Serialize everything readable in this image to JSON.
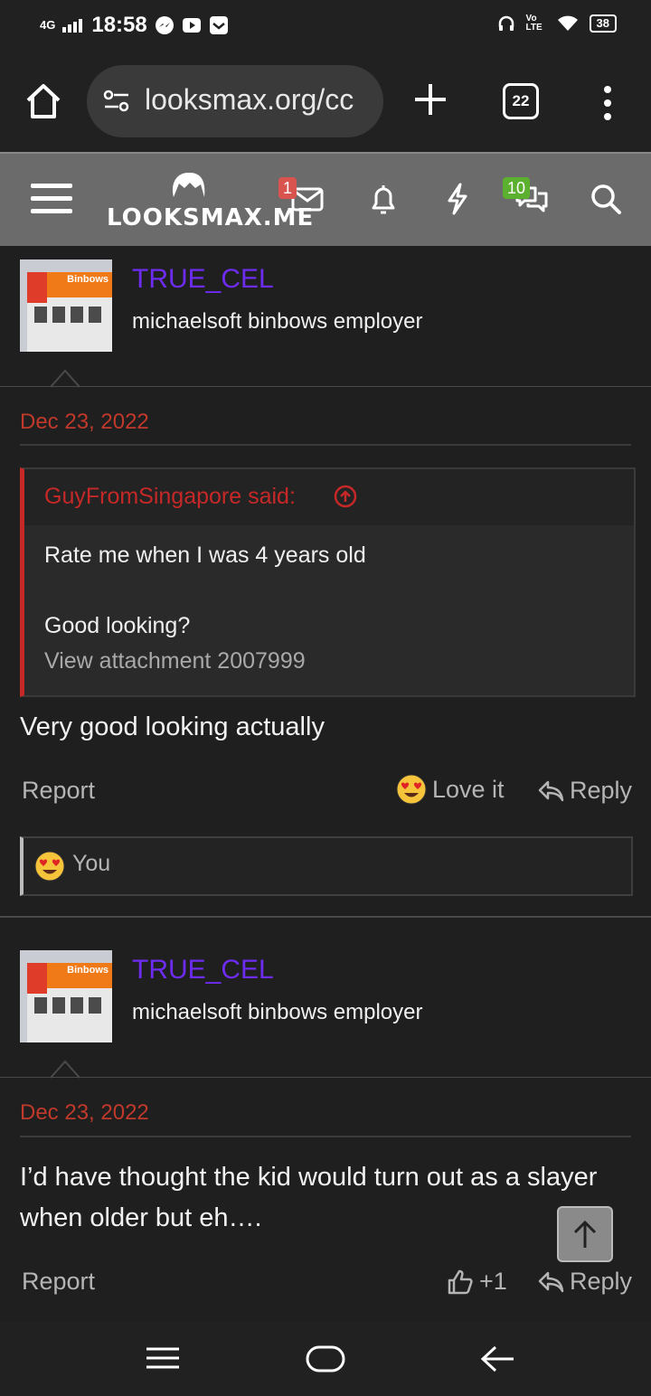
{
  "status_bar": {
    "network": "4G",
    "time": "18:58",
    "volte": "Vo LTE",
    "battery": "38"
  },
  "browser": {
    "url": "looksmax.org/cc",
    "tab_count": "22"
  },
  "site": {
    "logo_text": "LOOKSMAX.ME",
    "inbox_badge": "1",
    "conversations_badge": "10"
  },
  "posts": [
    {
      "username": "TRUE_CEL",
      "user_title": "michaelsoft binbows employer",
      "avatar_sign": "Binbows",
      "date": "Dec 23, 2022",
      "quote": {
        "author": "GuyFromSingapore said:",
        "line1": "Rate me when I was 4 years old",
        "line2": "Good looking?",
        "attachment": "View attachment 2007999"
      },
      "body": "Very good looking actually",
      "report": "Report",
      "reaction_label": "Love it",
      "reply": "Reply",
      "reactions_you": "You"
    },
    {
      "username": "TRUE_CEL",
      "user_title": "michaelsoft binbows employer",
      "avatar_sign": "Binbows",
      "date": "Dec 23, 2022",
      "body": "I’d have thought the kid would turn out as a slayer when older but eh….",
      "report": "Report",
      "reaction_label": "+1",
      "reply": "Reply"
    }
  ],
  "colors": {
    "username": "#6e2cf2",
    "date": "#c0392b",
    "quote_accent": "#c62828",
    "header_bg": "#6b6b6b"
  }
}
